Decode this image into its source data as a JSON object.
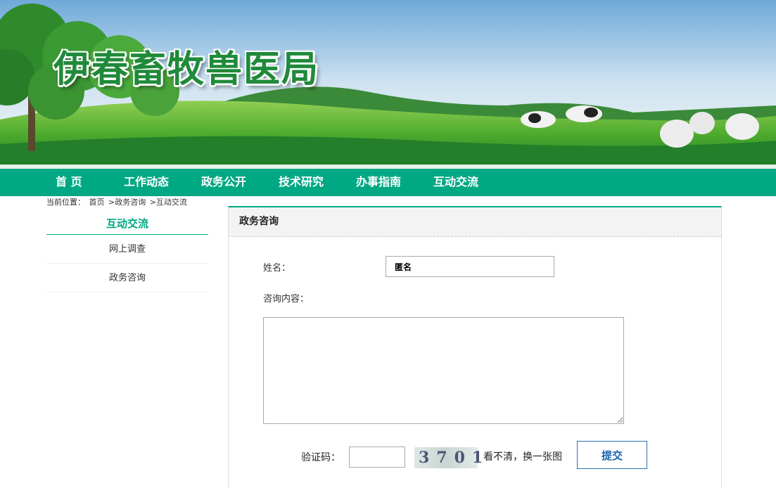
{
  "header": {
    "site_title": "伊春畜牧兽医局"
  },
  "nav": {
    "items": [
      {
        "label": "首  页"
      },
      {
        "label": "工作动态"
      },
      {
        "label": "政务公开"
      },
      {
        "label": "技术研究"
      },
      {
        "label": "办事指南"
      },
      {
        "label": "互动交流"
      }
    ]
  },
  "breadcrumb": {
    "prefix": "当前位置：",
    "items": [
      "首页",
      ">政务咨询",
      ">互动交流"
    ]
  },
  "sidebar": {
    "title": "互动交流",
    "items": [
      {
        "label": "网上调查"
      },
      {
        "label": "政务咨询"
      }
    ]
  },
  "panel": {
    "title": "政务咨询",
    "form": {
      "name_label": "姓名：",
      "name_value": "匿名",
      "content_label": "咨询内容：",
      "content_value": "",
      "captcha_label": "验证码：",
      "captcha_value": "",
      "captcha_image_text": "3701",
      "captcha_refresh": "看不清，换一张图",
      "submit_label": "提交"
    }
  },
  "colors": {
    "accent": "#00a883",
    "button_text": "#1a64b0"
  }
}
